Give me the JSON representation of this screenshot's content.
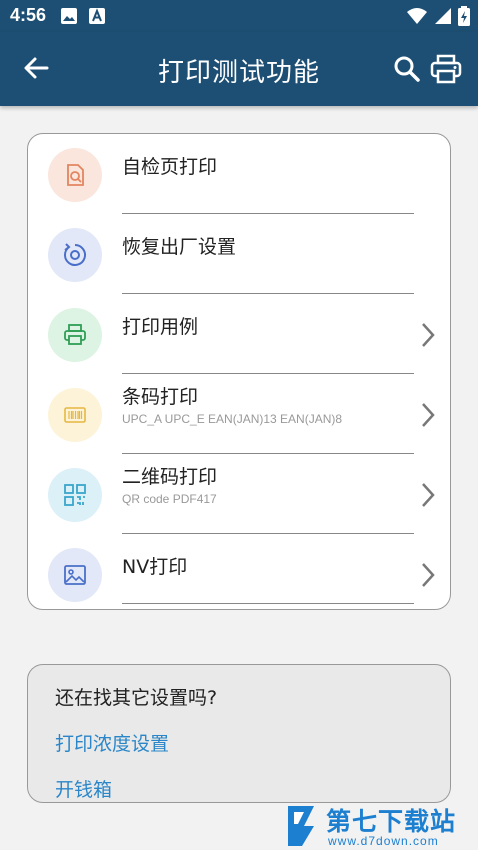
{
  "status_bar": {
    "time": "4:56"
  },
  "app_bar": {
    "title": "打印测试功能"
  },
  "menu": {
    "items": [
      {
        "title": "自检页打印",
        "subtitle": "",
        "icon": "document-search-icon",
        "has_chevron": false
      },
      {
        "title": "恢复出厂设置",
        "subtitle": "",
        "icon": "reset-icon",
        "has_chevron": false
      },
      {
        "title": "打印用例",
        "subtitle": "",
        "icon": "printer-icon",
        "has_chevron": true
      },
      {
        "title": "条码打印",
        "subtitle": "UPC_A UPC_E EAN(JAN)13 EAN(JAN)8",
        "icon": "barcode-icon",
        "has_chevron": true
      },
      {
        "title": "二维码打印",
        "subtitle": "QR code PDF417",
        "icon": "qrcode-icon",
        "has_chevron": true
      },
      {
        "title": "NV打印",
        "subtitle": "",
        "icon": "image-icon",
        "has_chevron": true
      }
    ]
  },
  "other_settings": {
    "title": "还在找其它设置吗?",
    "link_density": "打印浓度设置",
    "link_cash_drawer": "开钱箱"
  },
  "watermark": {
    "name": "第七下载站",
    "url": "www.d7down.com"
  },
  "colors": {
    "app_bar": "#1d4f74",
    "link": "#2a86c8"
  }
}
